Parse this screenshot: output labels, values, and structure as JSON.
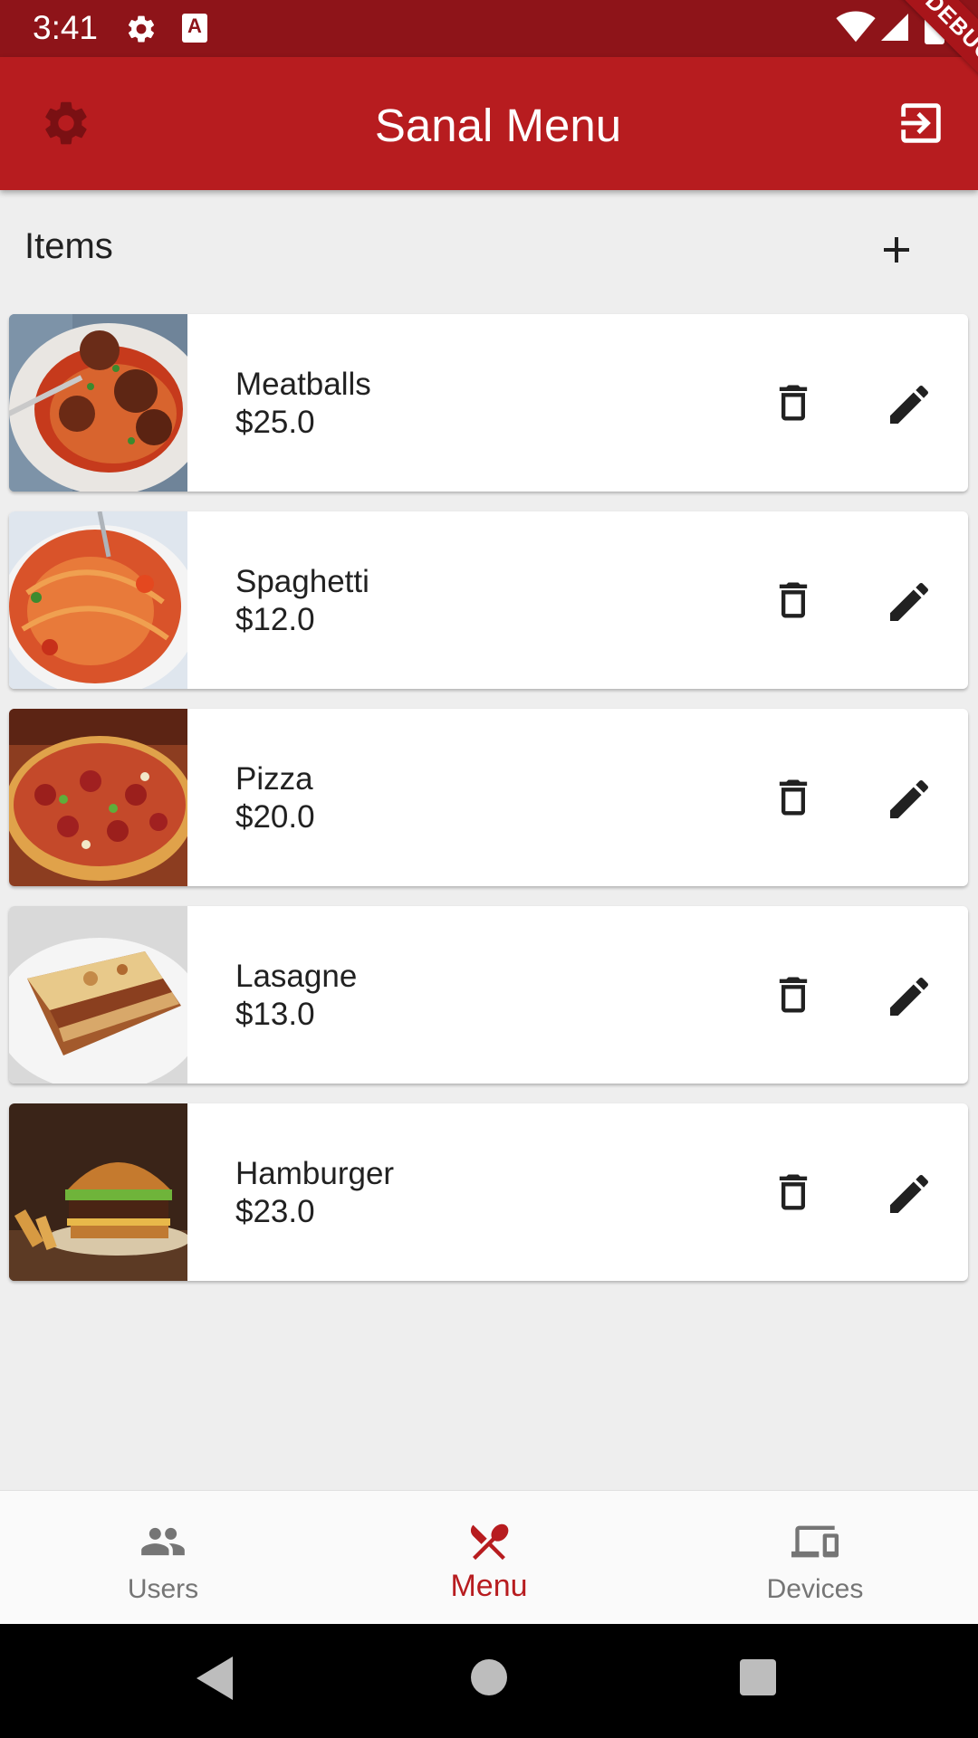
{
  "status_bar": {
    "time": "3:41",
    "icons": [
      "gear-icon",
      "font-a-icon",
      "wifi-icon",
      "signal-icon",
      "battery-icon"
    ],
    "a_glyph": "A"
  },
  "debug_banner": "DEBUG",
  "app_bar": {
    "title": "Sanal Menu",
    "left_icon": "settings-icon",
    "right_icon": "logout-icon"
  },
  "section": {
    "title": "Items",
    "action_icon": "add-icon"
  },
  "items": [
    {
      "name": "Meatballs",
      "price": "$25.0",
      "image": "meatballs-spaghetti-photo"
    },
    {
      "name": "Spaghetti",
      "price": "$12.0",
      "image": "spaghetti-photo"
    },
    {
      "name": "Pizza",
      "price": "$20.0",
      "image": "pizza-photo"
    },
    {
      "name": "Lasagne",
      "price": "$13.0",
      "image": "lasagne-photo"
    },
    {
      "name": "Hamburger",
      "price": "$23.0",
      "image": "hamburger-photo"
    }
  ],
  "bottom_nav": {
    "items": [
      {
        "label": "Users",
        "icon": "people-icon",
        "active": false
      },
      {
        "label": "Menu",
        "icon": "fork-spoon-icon",
        "active": true
      },
      {
        "label": "Devices",
        "icon": "devices-icon",
        "active": false
      }
    ]
  },
  "colors": {
    "status_bar": "#8e1419",
    "app_bar": "#b71c1f",
    "accent": "#b71c1f",
    "settings_icon": "#7a1013",
    "background": "#eeeeee",
    "card": "#ffffff",
    "inactive_nav": "#757575"
  }
}
